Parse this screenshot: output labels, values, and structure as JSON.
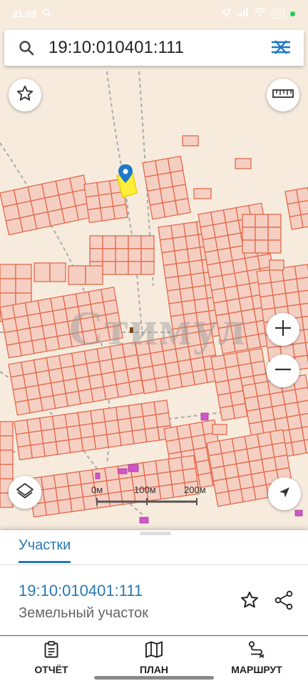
{
  "status_bar": {
    "time": "21:09",
    "battery": "83"
  },
  "search": {
    "value": "19:10:010401:111"
  },
  "map": {
    "scale_labels": [
      "0м",
      "100м",
      "200м"
    ],
    "watermark": "Стимул"
  },
  "panel": {
    "tab_label": "Участки",
    "parcel_id": "19:10:010401:111",
    "parcel_type": "Земельный участок"
  },
  "bottom_nav": [
    {
      "label": "ОТЧЁТ",
      "icon": "report-icon"
    },
    {
      "label": "ПЛАН",
      "icon": "map-plan-icon"
    },
    {
      "label": "МАРШРУТ",
      "icon": "route-icon"
    }
  ],
  "colors": {
    "map_bg": "#f6ebdd",
    "parcel_fill": "#f6cfc3",
    "parcel_stroke": "#e26a4a",
    "selected_parcel": "#ffee3a",
    "pin": "#1e78c8",
    "accent": "#2878b6"
  }
}
